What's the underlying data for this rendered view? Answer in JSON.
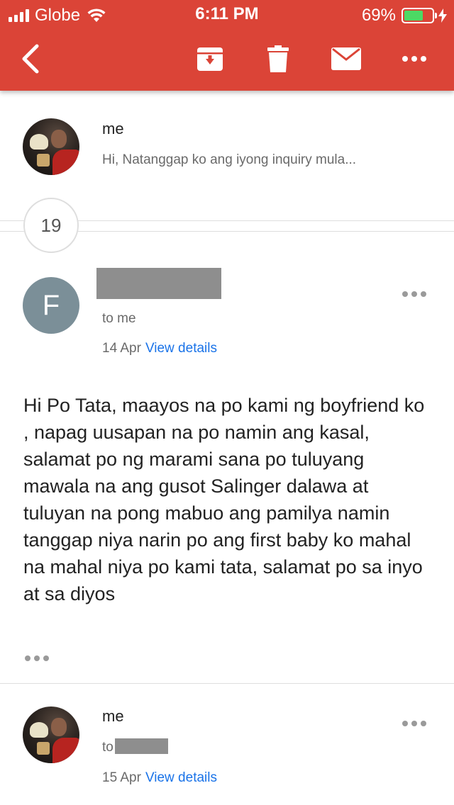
{
  "status_bar": {
    "carrier": "Globe",
    "time": "6:11 PM",
    "battery": "69%",
    "battery_level": 0.69,
    "battery_color": "#4cd964"
  },
  "toolbar": {
    "background_color": "#db4437",
    "icons": [
      "back-arrow-icon",
      "archive-icon",
      "trash-icon",
      "mail-icon",
      "more-icon"
    ]
  },
  "collapsed_message": {
    "sender": "me",
    "snippet": "Hi, Natanggap ko ang iyong inquiry mula..."
  },
  "hidden_count": "19",
  "message": {
    "avatar_letter": "F",
    "recipient": "to me",
    "date": "14 Apr",
    "details_link": "View details",
    "body": "Hi Po Tata, maayos na po kami ng boyfriend ko , napag uusapan na po namin ang kasal, salamat po ng marami sana po tuluyang mawala na ang gusot Salinger dalawa at tuluyan na pong mabuo ang pamilya namin tanggap niya narin po ang first baby ko mahal na mahal niya po kami tata, salamat po sa inyo at sa diyos"
  },
  "reply_message": {
    "sender": "me",
    "recipient_prefix": "to",
    "date": "15 Apr",
    "details_link": "View details"
  }
}
